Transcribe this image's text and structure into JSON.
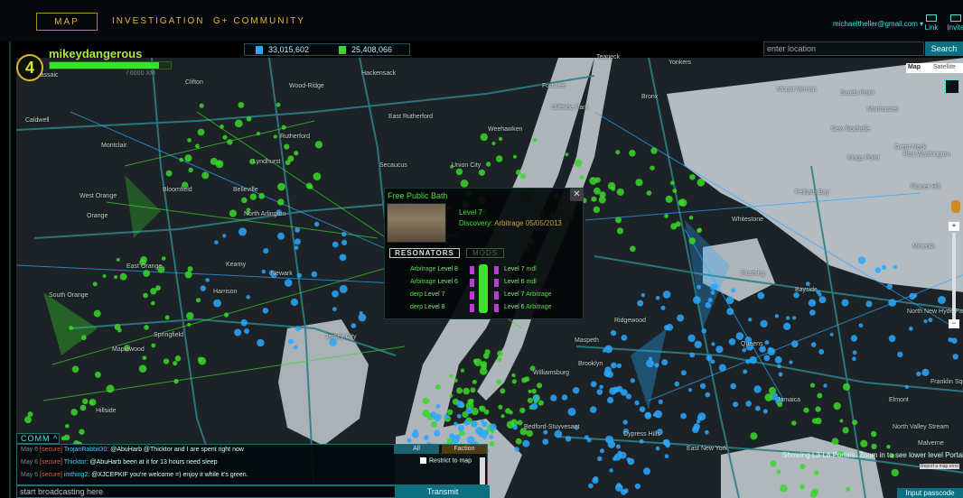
{
  "nav": {
    "tabs": [
      {
        "label": "MAP"
      },
      {
        "label": "INVESTIGATION"
      },
      {
        "label": "G+ COMMUNITY"
      }
    ],
    "user_email": "michaeltheller@gmail.com",
    "link_label": "Link",
    "invite_label": "Invite"
  },
  "player": {
    "level": "4",
    "name": "mikeydangerous",
    "xp_progress": 0.9,
    "xp_text": "/ 6000 XM"
  },
  "scores": {
    "resistance": "33,015,602",
    "enlightened": "25,408,066"
  },
  "location": {
    "placeholder": "enter location",
    "search_label": "Search"
  },
  "map_type": {
    "map": "Map",
    "satellite": "Satellite"
  },
  "labels": [
    "Clifton",
    "Passaic",
    "Wood-Ridge",
    "Rutherford",
    "Lyndhurst",
    "North Arlington",
    "Caldwell",
    "Montclair",
    "Bloomfield",
    "West Orange",
    "Orange",
    "East Orange",
    "South Orange",
    "Belleville",
    "Kearny",
    "Newark",
    "Jersey City",
    "Hoboken",
    "Weehawken",
    "Union City",
    "Bronx",
    "Yonkers",
    "Mount Vernon",
    "New Rochelle",
    "Pelham Bay",
    "Whitestone",
    "Flushing",
    "Bayside",
    "Queens",
    "Jamaica",
    "Brooklyn",
    "Bedford-Stuyvesant",
    "Williamsburg",
    "Hillside",
    "Maspeth",
    "Ridgewood",
    "Manhasset",
    "Great Neck",
    "Port Washington",
    "Sands Point",
    "Kings Point",
    "Mineola",
    "North New Hyde Park",
    "Elmont",
    "Franklin Square",
    "North Valley Stream",
    "Malverne",
    "Cypress Hills",
    "East New York",
    "Springfield",
    "Maplewood",
    "Harrison",
    "Fort Lee",
    "Cliffside Park",
    "Teaneck",
    "Hackensack",
    "East Rutherford",
    "Secaucus",
    "Flower Hill"
  ],
  "portal": {
    "title": "Free Public Bath",
    "level": "Level 7",
    "discovery_label": "Discovery:",
    "discovery_value": "Arbitrage 05/05/2013",
    "tab_resonators": "RESONATORS",
    "tab_mods": "MODS",
    "resonators_left": [
      {
        "owner": "Arbitrage",
        "level": "Level 8"
      },
      {
        "owner": "Arbitrage",
        "level": "Level 6"
      },
      {
        "owner": "derp",
        "level": "Level 7"
      },
      {
        "owner": "derp",
        "level": "Level 8"
      }
    ],
    "resonators_right": [
      {
        "level": "Level 7",
        "owner": "mdl"
      },
      {
        "level": "Level 6",
        "owner": "mdl"
      },
      {
        "level": "Level 7",
        "owner": "Arbitrage"
      },
      {
        "level": "Level 6",
        "owner": "Arbitrage"
      }
    ]
  },
  "comm": {
    "tab_label": "COMM",
    "filter_all": "All",
    "filter_faction": "Faction",
    "restrict_label": "Restrict to map",
    "messages": [
      {
        "date": "May 6",
        "tag": "[secure]",
        "user": "TrojanRabbit30:",
        "text": "@AbuHarb @Thicktor and I are spent right now"
      },
      {
        "date": "May 6",
        "tag": "[secure]",
        "user": "Thicktor:",
        "text": "@AbuHarb been at it for 13 hours need sleep"
      },
      {
        "date": "May 6",
        "tag": "[secure]",
        "user": "imthing2:",
        "text": "@XJCEPKIF you're welcome =) enjoy it while it's green."
      }
    ],
    "broadcast_placeholder": "start broadcasting here",
    "transmit_label": "Transmit"
  },
  "map_status": "Showing L3-L8 Portals. Zoom in to see lower level Portals.",
  "report_error": "Report a map error",
  "passcode_label": "Input passcode",
  "colors": {
    "enlightened": "#39d72a",
    "resistance": "#2aa8ff",
    "accent": "#4ee0e6"
  }
}
